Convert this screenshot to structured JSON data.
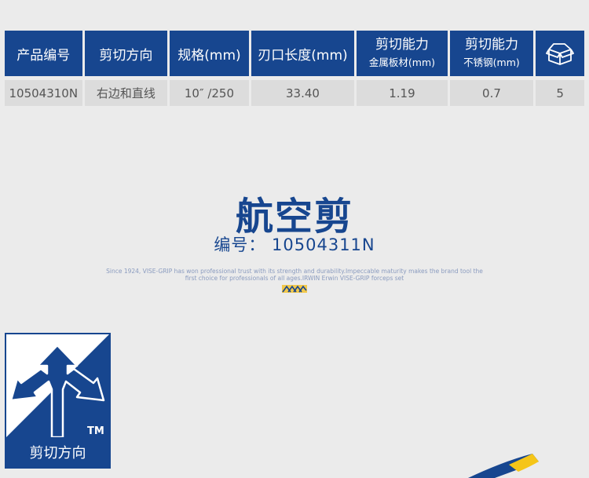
{
  "spec_table": {
    "headers": [
      {
        "main": "产品编号"
      },
      {
        "main": "剪切方向"
      },
      {
        "main": "规格(mm)"
      },
      {
        "main": "刃口长度(mm)"
      },
      {
        "main": "剪切能力",
        "sub": "金属板材(mm)"
      },
      {
        "main": "剪切能力",
        "sub": "不锈钢(mm)"
      },
      {
        "icon": "box-icon"
      }
    ],
    "rows": [
      [
        "10504310N",
        "右边和直线",
        "10″ /250",
        "33.40",
        "1.19",
        "0.7",
        "5"
      ]
    ]
  },
  "product": {
    "title": "航空剪",
    "code_label": "编号： 10504311N"
  },
  "tagline": {
    "line1": "Since 1924, VISE-GRIP has won professional trust with its strength and durability.Impeccable maturity makes the brand tool the",
    "line2": "first choice for professionals of all ages.IRWIN Erwin VISE-GRIP forceps set"
  },
  "badge": {
    "label": "剪切方向",
    "trademark": "TM",
    "icon": "three-direction-arrows-icon"
  },
  "colors": {
    "brand_blue": "#17468f",
    "cell_gray": "#dcdcdc",
    "background": "#ebebeb",
    "accent_yellow": "#f5c518"
  }
}
